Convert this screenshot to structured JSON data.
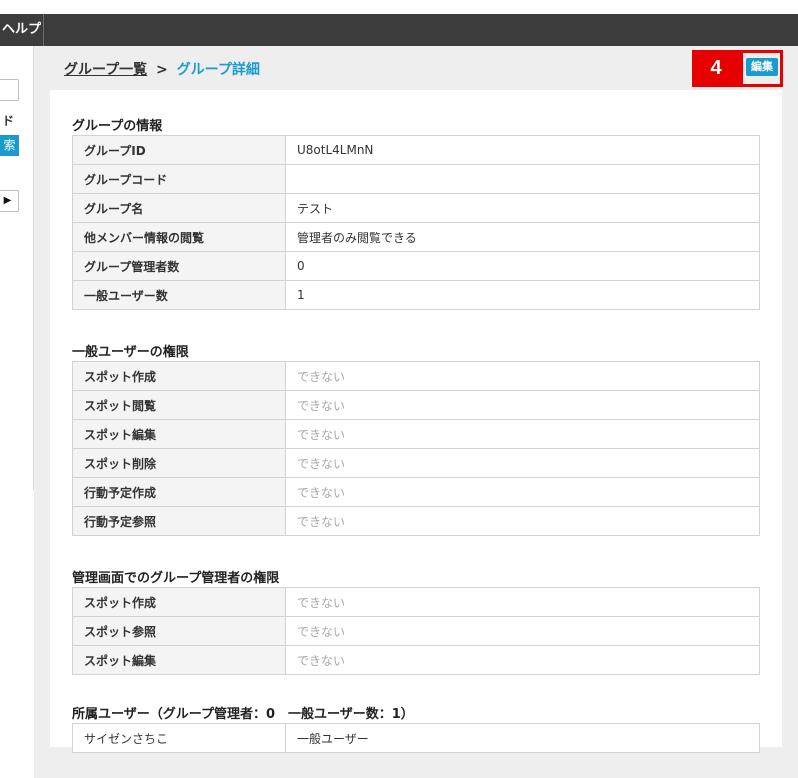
{
  "header": {
    "help_label": "ヘルプ"
  },
  "sidebar": {
    "label_fragment": "ド",
    "search_fragment": "索",
    "arrow": "▶"
  },
  "breadcrumb": {
    "parent": "グループ一覧",
    "separator": ">",
    "current": "グループ詳細"
  },
  "annotation": {
    "badge_number": "4"
  },
  "toolbar": {
    "edit_label": "編集"
  },
  "group_info": {
    "title": "グループの情報",
    "rows": [
      {
        "label": "グループID",
        "value": "U8otL4LMnN"
      },
      {
        "label": "グループコード",
        "value": ""
      },
      {
        "label": "グループ名",
        "value": "テスト"
      },
      {
        "label": "他メンバー情報の閲覧",
        "value": "管理者のみ閲覧できる"
      },
      {
        "label": "グループ管理者数",
        "value": "0"
      },
      {
        "label": "一般ユーザー数",
        "value": "1"
      }
    ]
  },
  "user_permissions": {
    "title": "一般ユーザーの権限",
    "rows": [
      {
        "label": "スポット作成",
        "value": "できない"
      },
      {
        "label": "スポット閲覧",
        "value": "できない"
      },
      {
        "label": "スポット編集",
        "value": "できない"
      },
      {
        "label": "スポット削除",
        "value": "できない"
      },
      {
        "label": "行動予定作成",
        "value": "できない"
      },
      {
        "label": "行動予定参照",
        "value": "できない"
      }
    ]
  },
  "admin_permissions": {
    "title": "管理画面でのグループ管理者の権限",
    "rows": [
      {
        "label": "スポット作成",
        "value": "できない"
      },
      {
        "label": "スポット参照",
        "value": "できない"
      },
      {
        "label": "スポット編集",
        "value": "できない"
      }
    ]
  },
  "members": {
    "title": "所属ユーザー（グループ管理者：0　一般ユーザー数：1）",
    "rows": [
      {
        "name": "サイゼンさちこ",
        "role": "一般ユーザー"
      }
    ]
  }
}
